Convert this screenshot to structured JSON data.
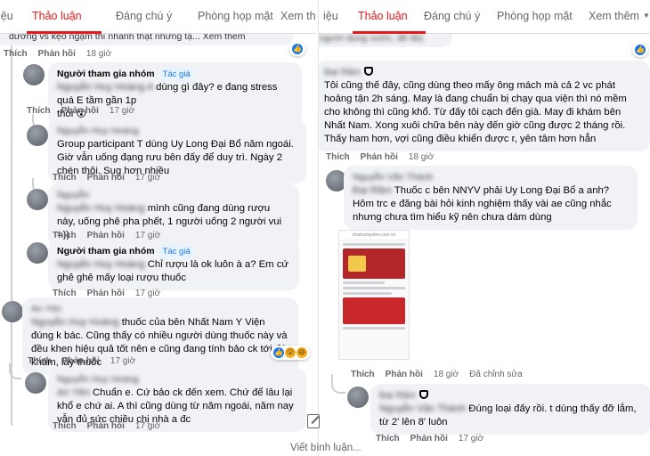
{
  "left": {
    "tabs": [
      {
        "label": "iệu"
      },
      {
        "label": "Thảo luận",
        "active": true
      },
      {
        "label": "Đáng chú ý"
      },
      {
        "label": "Phòng họp mặt"
      },
      {
        "label": "Xem thêm"
      }
    ],
    "top_partial": {
      "text": "đường vs kẹo ngậm thì nhanh thật nhưng tạ... Xem thêm",
      "actions": [
        "Thích",
        "Phản hồi",
        "18 giờ"
      ]
    },
    "comments": [
      {
        "author": "Người tham gia nhóm",
        "badge": "Tác giả",
        "name_blur": "Nguyễn Huy Hoàng A",
        "text_inline": "dùng gì đây? e đang stress quá E tầm gần 1p",
        "text": "thôi 😮",
        "actions": [
          "Thích",
          "Phản hồi",
          "17 giờ"
        ]
      },
      {
        "author": "Nguyễn Huy Hoàng",
        "text": "Group participant T dùng Uy Long Đại Bổ năm ngoái. Giờ vẫn uống đạng rưu bên đấy để duy trì. Ngày 2 chén thôi. Sug hơn nhiều",
        "actions": [
          "Thích",
          "Phản hồi",
          "17 giờ"
        ]
      },
      {
        "author": "Nguyễn",
        "name_blur": "Nguyễn Huy Hoàng",
        "text": "mình cũng đang dùng rượu này, uống phê pha phết, 1 người uống 2 người vui =))",
        "actions": [
          "Thích",
          "Phản hồi",
          "17 giờ"
        ]
      },
      {
        "author": "Người tham gia nhóm",
        "badge": "Tác giả",
        "name_blur": "Nguyễn Huy Hoàng",
        "text": "Chỉ rượu là ok luôn à a? Em cứ ghê ghê mấy loại rượu thuốc",
        "actions": [
          "Thích",
          "Phản hồi",
          "17 giờ"
        ]
      },
      {
        "author": "An Yên",
        "name_blur": "Nguyễn Huy Hoàng",
        "text": "thuốc của bên Nhất Nam Y Viện đúng k bác. Cũng thấy có nhiều người dùng thuốc này và đều khen hiệu quả tốt nên e cũng đang tính bảo ck tới đó khám, lấy thuốc",
        "actions": [
          "Thích",
          "Phản hồi",
          "17 giờ"
        ]
      },
      {
        "author": "Nguyễn Huy Hoàng",
        "name_blur": "An Yên",
        "text": "Chuẩn e. Cứ bảo ck đến xem. Chứ để lâu lại khổ e chứ ai. A thì cũng dùng từ năm ngoái, năm nay vẫn đủ sức chiều chị nhà a đc",
        "actions": [
          "Thích",
          "Phản hồi",
          "17 giờ"
        ]
      }
    ],
    "write_placeholder": "Viết bình luận..."
  },
  "right": {
    "tabs": [
      {
        "label": "iệu"
      },
      {
        "label": "Thảo luận",
        "active": true
      },
      {
        "label": "Đáng chú ý"
      },
      {
        "label": "Phòng họp mặt"
      },
      {
        "label": "Xem thêm"
      }
    ],
    "top_partial": {
      "text": "người dùng nước, đẻ đủi."
    },
    "comments": [
      {
        "author": "Đại Râm",
        "text": "Tôi cũng thế đây, cũng dùng theo mấy ông mách mà cả 2 vc phát hoảng tận 2h sáng. May là đang chuẩn bị chạy qua viện thì nó mềm cho không thì cũng khổ. Từ đấy tôi cạch đến già. May đi khám bên Nhất Nam. Xong xuôi chữa bên này đến giờ cũng được 2 tháng rồi. Thấy ham hơn, vợi cũng điều khiển được r, yên tâm hơn hẳn",
        "actions": [
          "Thích",
          "Phản hồi",
          "18 giờ"
        ]
      },
      {
        "author": "Nguyễn Văn Thành",
        "name_blur": "Đại Râm",
        "text": "Thuốc c bên NNYV phải Uy Long Đại Bổ a anh? Hôm trc e đăng bài hỏi kinh nghiệm thấy vài ae cũng nhắc nhưng chưa tìm hiểu kỹ nên chưa dám dùng",
        "image_source": "nhatnamyvien.com.vn",
        "actions": [
          "Thích",
          "Phản hồi",
          "18 giờ",
          "Đã chỉnh sửa"
        ]
      },
      {
        "author": "Đại Râm",
        "name_blur": "Nguyễn Văn Thành",
        "text": "Đúng loại đấy rồi. t dùng thấy đỡ lắm, từ 2' lên 8' luôn",
        "actions": [
          "Thích",
          "Phản hồi",
          "17 giờ"
        ]
      }
    ]
  },
  "colors": {
    "accent": "#e4191c",
    "link": "#1877f2",
    "bubble": "#f0f2f5",
    "muted": "#65676b"
  },
  "icons": [
    "chevron-down-icon",
    "like-reaction-icon",
    "wow-reaction-icon",
    "haha-reaction-icon",
    "compose-icon",
    "pin-hand-icon"
  ]
}
